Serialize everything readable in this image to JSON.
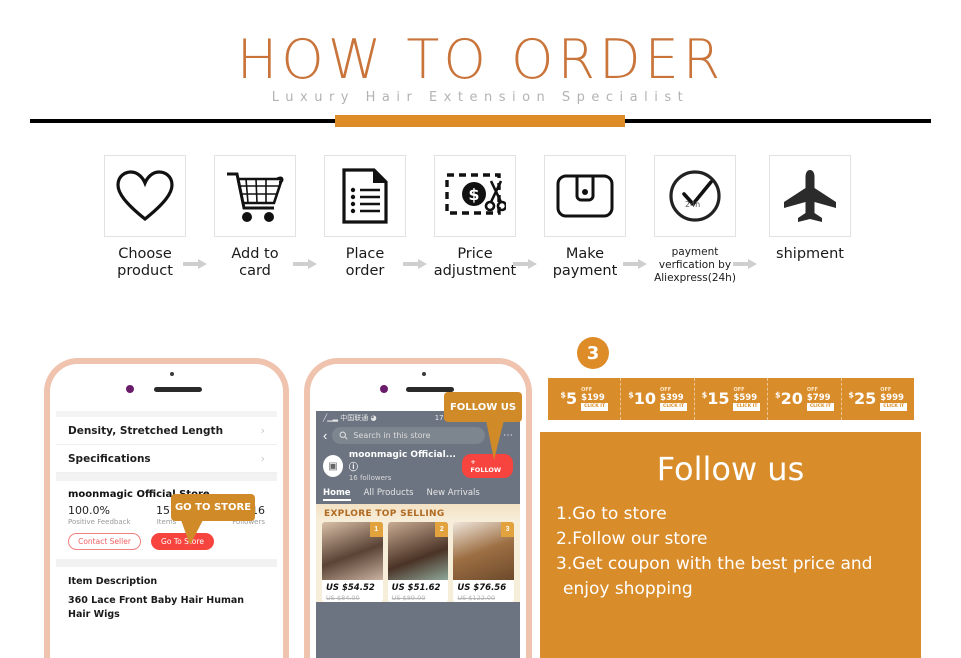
{
  "header": {
    "title": "HOW TO ORDER",
    "subtitle": "Luxury Hair Extension Specialist"
  },
  "steps": [
    {
      "icon": "heart-icon",
      "label_line1": "Choose",
      "label_line2": "product"
    },
    {
      "icon": "cart-icon",
      "label_line1": "Add to",
      "label_line2": "card"
    },
    {
      "icon": "document-icon",
      "label_line1": "Place",
      "label_line2": "order"
    },
    {
      "icon": "price-cut-icon",
      "label_line1": "Price",
      "label_line2": "adjustment"
    },
    {
      "icon": "wallet-icon",
      "label_line1": "Make",
      "label_line2": "payment"
    },
    {
      "icon": "clock-check-icon",
      "label_line1": "payment",
      "label_line2": "verfication by",
      "label_line3": "Aliexpress(24h)",
      "icon_text": "24h"
    },
    {
      "icon": "airplane-icon",
      "label_line1": "shipment",
      "label_line2": ""
    }
  ],
  "left_phone": {
    "rows": [
      {
        "label": "Density, Stretched Length"
      },
      {
        "label": "Specifications"
      }
    ],
    "store_name": "moonmagic Official Store",
    "stats": [
      {
        "value": "100.0%",
        "label": "Positive Feedback"
      },
      {
        "value": "157",
        "label": "Items"
      },
      {
        "value": "16",
        "label": "Followers"
      }
    ],
    "contact_button": "Contact Seller",
    "store_button": "Go To Store",
    "description_heading": "Item Description",
    "description_text": "360 Lace Front Baby Hair Human Hair Wigs",
    "callout": "GO TO STORE"
  },
  "right_phone": {
    "carrier": "中国联通",
    "time": "17:06",
    "search_placeholder": "Search in this store",
    "store_name": "moonmagic Official...",
    "followers": "16  followers",
    "follow_button": "+ FOLLOW",
    "tabs": [
      {
        "label": "Home",
        "active": true
      },
      {
        "label": "All Products",
        "active": false
      },
      {
        "label": "New Arrivals",
        "active": false
      }
    ],
    "banner": "EXPLORE TOP SELLING",
    "products": [
      {
        "rank": "1",
        "price": "US $54.52",
        "old_price": "US $84.00"
      },
      {
        "rank": "2",
        "price": "US $51.62",
        "old_price": "US $89.00"
      },
      {
        "rank": "3",
        "price": "US $76.56",
        "old_price": "US $122.00"
      }
    ],
    "callout": "FOLLOW US"
  },
  "right_panel": {
    "badge": "3",
    "coupons": [
      {
        "amount": "5",
        "currency": "$",
        "off": "OFF",
        "min": "$199",
        "click": "CLICK IT"
      },
      {
        "amount": "10",
        "currency": "$",
        "off": "OFF",
        "min": "$399",
        "click": "CLICK IT"
      },
      {
        "amount": "15",
        "currency": "$",
        "off": "OFF",
        "min": "$599",
        "click": "CLICK IT"
      },
      {
        "amount": "20",
        "currency": "$",
        "off": "OFF",
        "min": "$799",
        "click": "CLICK IT"
      },
      {
        "amount": "25",
        "currency": "$",
        "off": "OFF",
        "min": "$999",
        "click": "CLICK IT"
      }
    ],
    "title": "Follow us",
    "steps": [
      "1.Go to store",
      "2.Follow our store",
      "3.Get coupon with the best price and",
      " enjoy shopping"
    ]
  },
  "colors": {
    "accent_orange": "#d98c2a",
    "title_brown": "#c9743a",
    "red": "#f7443e",
    "subtitle_gray": "#b3b3b3"
  }
}
